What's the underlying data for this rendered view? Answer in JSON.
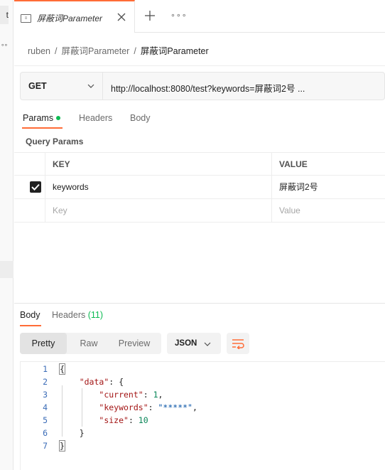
{
  "sidebar": {
    "tab_fragment": "t",
    "more": "∘∘"
  },
  "tabbar": {
    "tab_icon_text": "≡",
    "tab_title": "屏蔽词Parameter",
    "more": "∘∘∘"
  },
  "breadcrumb": {
    "items": [
      "ruben",
      "屏蔽词Parameter"
    ],
    "separator": "/",
    "current": "屏蔽词Parameter"
  },
  "request": {
    "method": "GET",
    "url": "http://localhost:8080/test?keywords=屏蔽词2号 ..."
  },
  "request_tabs": [
    {
      "label": "Params",
      "active": true,
      "indicator": "green-dot"
    },
    {
      "label": "Headers",
      "active": false
    },
    {
      "label": "Body",
      "active": false
    }
  ],
  "query_params": {
    "title": "Query Params",
    "headers": {
      "key": "KEY",
      "value": "VALUE"
    },
    "rows": [
      {
        "checked": true,
        "key": "keywords",
        "value": "屏蔽词2号"
      }
    ],
    "placeholder": {
      "key": "Key",
      "value": "Value"
    }
  },
  "response": {
    "tabs": {
      "body": "Body",
      "headers": "Headers",
      "headers_count": "(11)"
    },
    "views": [
      "Pretty",
      "Raw",
      "Preview"
    ],
    "active_view": "Pretty",
    "format": "JSON",
    "code_lines": [
      {
        "n": "1",
        "indent": "",
        "parts": [
          [
            "{",
            "brace"
          ]
        ]
      },
      {
        "n": "2",
        "indent": "    ",
        "parts": [
          [
            "\"data\"",
            "key"
          ],
          [
            ": {",
            "p"
          ]
        ]
      },
      {
        "n": "3",
        "indent": "        ",
        "parts": [
          [
            "\"current\"",
            "key"
          ],
          [
            ": ",
            "p"
          ],
          [
            "1",
            "num"
          ],
          [
            ",",
            "p"
          ]
        ]
      },
      {
        "n": "4",
        "indent": "        ",
        "parts": [
          [
            "\"keywords\"",
            "key"
          ],
          [
            ": ",
            "p"
          ],
          [
            "\"*****\"",
            "str"
          ],
          [
            ",",
            "p"
          ]
        ]
      },
      {
        "n": "5",
        "indent": "        ",
        "parts": [
          [
            "\"size\"",
            "key"
          ],
          [
            ": ",
            "p"
          ],
          [
            "10",
            "num"
          ]
        ]
      },
      {
        "n": "6",
        "indent": "    ",
        "parts": [
          [
            "}",
            "p"
          ]
        ]
      },
      {
        "n": "7",
        "indent": "",
        "parts": [
          [
            "}",
            "brace"
          ]
        ]
      }
    ]
  },
  "colors": {
    "accent": "#ff6c37",
    "success": "#0cbb52"
  }
}
